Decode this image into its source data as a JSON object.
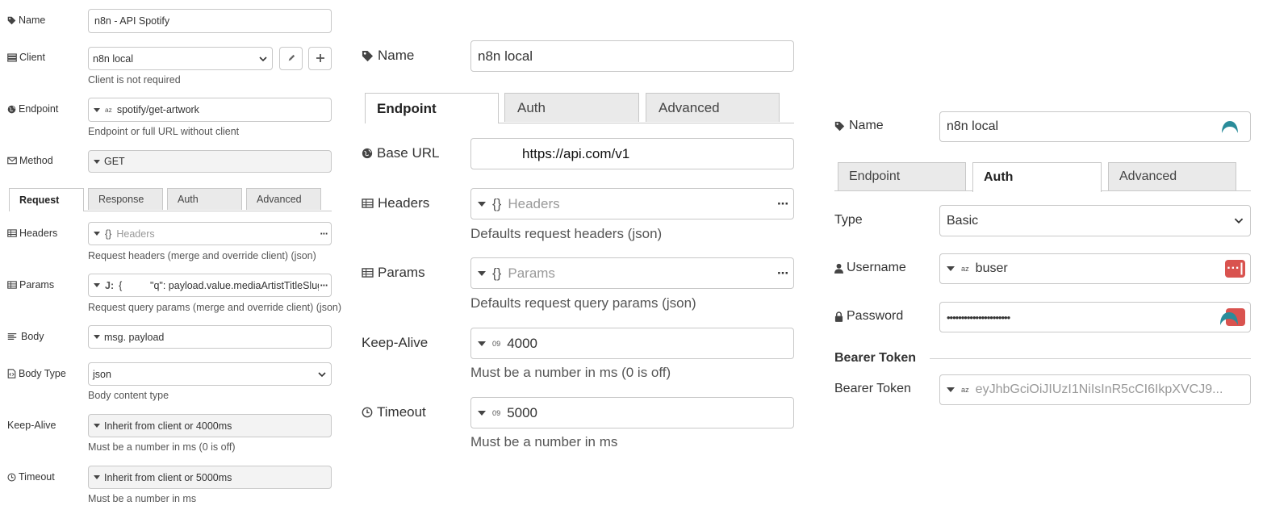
{
  "panel1": {
    "name": {
      "label": "Name",
      "value": "n8n - API Spotify"
    },
    "client": {
      "label": "Client",
      "value": "n8n local",
      "hint": "Client is not required"
    },
    "endpoint": {
      "label": "Endpoint",
      "type_icon": "az",
      "value": "spotify/get-artwork",
      "hint": "Endpoint or full URL without client"
    },
    "method": {
      "label": "Method",
      "value": "GET"
    },
    "tabs": [
      "Request",
      "Response",
      "Auth",
      "Advanced"
    ],
    "headers": {
      "label": "Headers",
      "type_icon": "{}",
      "placeholder": "Headers",
      "hint": "Request headers (merge and override client) (json)"
    },
    "params": {
      "label": "Params",
      "type_icon": "J:",
      "value": "{          \"q\": payload.value.mediaArtistTitleSlug",
      "hint": "Request query params (merge and override client) (json)"
    },
    "body": {
      "label": "Body",
      "value": "msg. payload"
    },
    "body_type": {
      "label": "Body Type",
      "value": "json",
      "hint": "Body content type"
    },
    "keep_alive": {
      "label": "Keep-Alive",
      "value": "Inherit from client or 4000ms",
      "hint": "Must be a number in ms (0 is off)"
    },
    "timeout": {
      "label": "Timeout",
      "value": "Inherit from client or 5000ms",
      "hint": "Must be a number in ms"
    }
  },
  "panel2": {
    "name": {
      "label": "Name",
      "value": "n8n local"
    },
    "tabs": [
      "Endpoint",
      "Auth",
      "Advanced"
    ],
    "base_url": {
      "label": "Base URL",
      "value": "https://api.com/v1"
    },
    "headers": {
      "label": "Headers",
      "type_icon": "{}",
      "placeholder": "Headers",
      "hint": "Defaults request headers (json)"
    },
    "params": {
      "label": "Params",
      "type_icon": "{}",
      "placeholder": "Params",
      "hint": "Defaults request query params (json)"
    },
    "keep_alive": {
      "label": "Keep-Alive",
      "type_icon": "09",
      "value": "4000",
      "hint": "Must be a number in ms (0 is off)"
    },
    "timeout": {
      "label": "Timeout",
      "type_icon": "09",
      "value": "5000",
      "hint": "Must be a number in ms"
    }
  },
  "panel3": {
    "name": {
      "label": "Name",
      "value": "n8n local"
    },
    "tabs": [
      "Endpoint",
      "Auth",
      "Advanced"
    ],
    "type": {
      "label": "Type",
      "value": "Basic"
    },
    "username": {
      "label": "Username",
      "type_icon": "az",
      "value": "buser"
    },
    "password": {
      "label": "Password",
      "value": "••••••••••••••••••••••"
    },
    "bearer_section": "Bearer Token",
    "bearer": {
      "label": "Bearer Token",
      "type_icon": "az",
      "placeholder": "eyJhbGciOiJIUzI1NiIsInR5cCI6IkpXVCJ9..."
    }
  },
  "colors": {
    "border": "#c8c8c8",
    "tab_bg": "#eaeaea",
    "key_red": "#d9534f",
    "logo_teal": "#2a8c9a"
  }
}
